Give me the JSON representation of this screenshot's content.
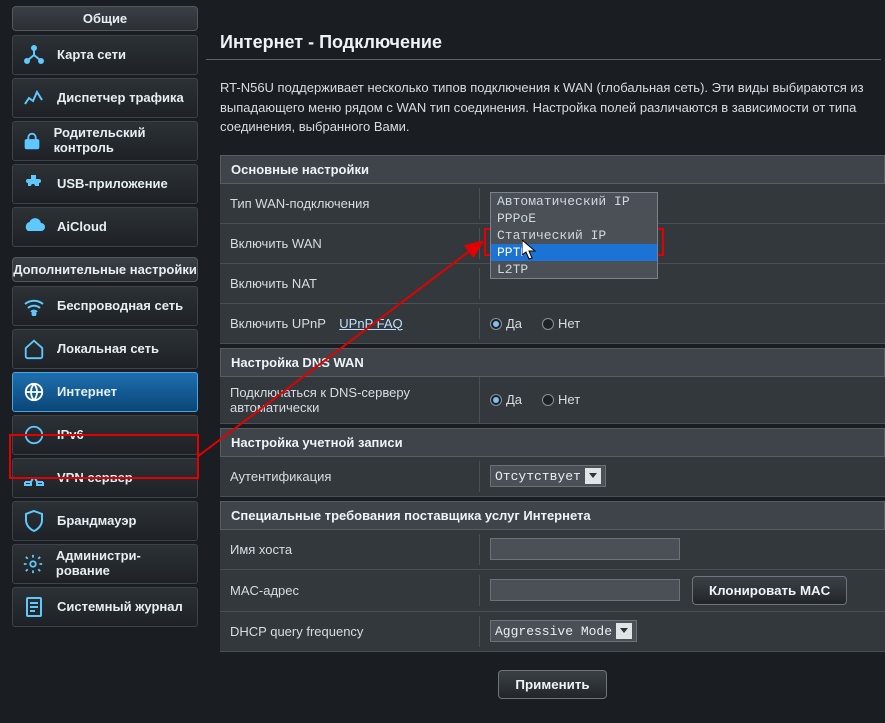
{
  "sidebar": {
    "general_header": "Общие",
    "advanced_header": "Дополнительные настройки",
    "general": [
      {
        "label": "Карта сети"
      },
      {
        "label": "Диспетчер трафика"
      },
      {
        "label": "Родительский контроль"
      },
      {
        "label": "USB-приложение"
      },
      {
        "label": "AiCloud"
      }
    ],
    "advanced": [
      {
        "label": "Беспроводная сеть"
      },
      {
        "label": "Локальная сеть"
      },
      {
        "label": "Интернет"
      },
      {
        "label": "IPv6"
      },
      {
        "label": "VPN сервер"
      },
      {
        "label": "Брандмауэр"
      },
      {
        "label": "Администри-рование"
      },
      {
        "label": "Системный журнал"
      }
    ]
  },
  "page": {
    "title": "Интернет - Подключение",
    "intro": "RT-N56U поддерживает несколько типов подключения к WAN (глобальная сеть). Эти виды выбираются из выпадающего меню рядом с WAN тип соединения. Настройка полей различаются в зависимости от типа соединения, выбранного Вами.",
    "sections": {
      "basic": "Основные настройки",
      "dns": "Настройка DNS WAN",
      "account": "Настройка учетной записи",
      "isp": "Специальные требования поставщика услуг Интернета"
    },
    "rows": {
      "wan_type": "Тип WAN-подключения",
      "enable_wan": "Включить WAN",
      "enable_nat": "Включить NAT",
      "enable_upnp": "Включить UPnP",
      "upnp_faq": "UPnP  FAQ",
      "dns_auto": "Подключаться к DNS-серверу автоматически",
      "auth": "Аутентификация",
      "hostname": "Имя хоста",
      "mac": "MAC-адрес",
      "dhcp_freq": "DHCP query frequency"
    },
    "values": {
      "wan_type_selected": "Автоматический IP",
      "auth_selected": "Отсутствует",
      "dhcp_selected": "Aggressive Mode",
      "yes": "Да",
      "no": "Нет"
    },
    "wan_options": [
      "Автоматический IP",
      "PPPoE",
      "Статический IP",
      "PPTP",
      "L2TP"
    ],
    "buttons": {
      "clone_mac": "Клонировать MAC",
      "apply": "Применить"
    }
  }
}
